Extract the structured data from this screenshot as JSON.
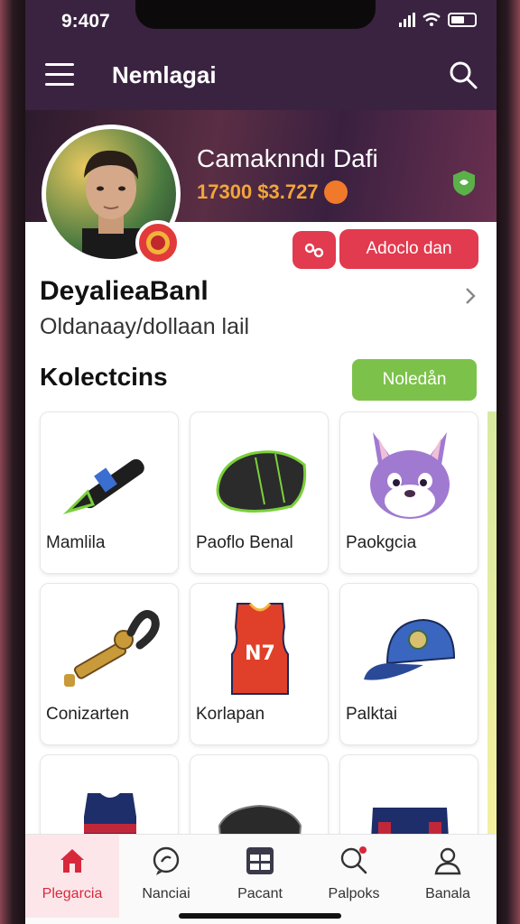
{
  "status": {
    "time": "9:407"
  },
  "app": {
    "title": "Nemlagai"
  },
  "profile": {
    "banner_name": "Camaknndı Dafi",
    "stats": "17300 $3.727",
    "action_label": "Adoclo dan",
    "name": "DeyalieaBanl",
    "subtitle": "Oldanaay/dollaan lail"
  },
  "collections": {
    "title": "Kolectcins",
    "button_label": "Noledån",
    "items": [
      {
        "label": "Mamlila",
        "icon": "flashlight-icon"
      },
      {
        "label": "Paoflo Benal",
        "icon": "glove-icon"
      },
      {
        "label": "Paokgcia",
        "icon": "fox-mascot-icon"
      },
      {
        "label": "Conizarten",
        "icon": "telescope-icon"
      },
      {
        "label": "Korlapan",
        "icon": "jersey-icon"
      },
      {
        "label": "Palktai",
        "icon": "cap-icon"
      },
      {
        "label": "",
        "icon": "jersey-icon"
      },
      {
        "label": "",
        "icon": "bag-icon"
      },
      {
        "label": "",
        "icon": "shorts-icon"
      }
    ]
  },
  "nav": [
    {
      "label": "Plegarcia",
      "icon": "home-icon"
    },
    {
      "label": "Nanciai",
      "icon": "chat-icon"
    },
    {
      "label": "Pacant",
      "icon": "grid-icon"
    },
    {
      "label": "Palpoks",
      "icon": "search-icon"
    },
    {
      "label": "Banala",
      "icon": "profile-icon"
    }
  ],
  "colors": {
    "header": "#3a2340",
    "accent_red": "#e23a4e",
    "accent_green": "#7cc24a",
    "stats_orange": "#f2a53a"
  }
}
